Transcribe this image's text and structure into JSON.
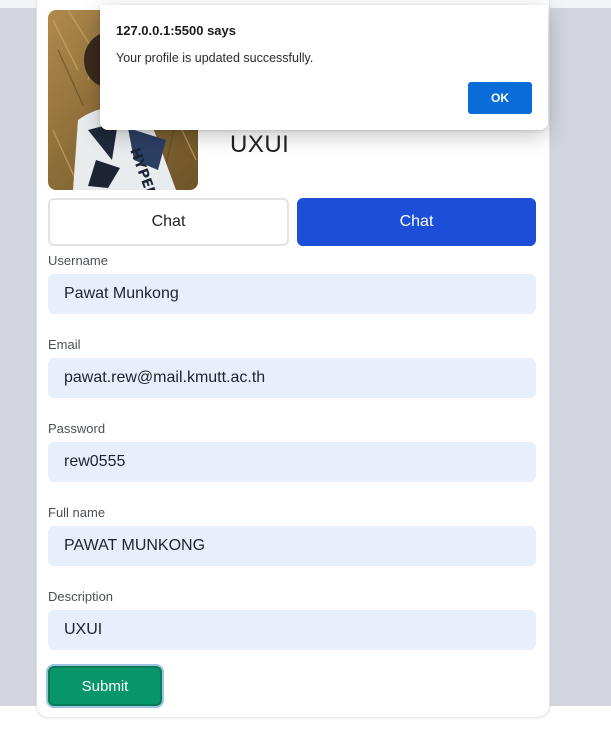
{
  "dialog": {
    "title": "127.0.0.1:5500 says",
    "message": "Your profile is updated successfully.",
    "ok_label": "OK"
  },
  "profile": {
    "name": "UXUI"
  },
  "buttons": {
    "chat_outline_label": "Chat",
    "chat_filled_label": "Chat",
    "submit_label": "Submit"
  },
  "form": {
    "fields": [
      {
        "label": "Username",
        "value": "Pawat Munkong"
      },
      {
        "label": "Email",
        "value": "pawat.rew@mail.kmutt.ac.th"
      },
      {
        "label": "Password",
        "value": "rew0555"
      },
      {
        "label": "Full name",
        "value": "PAWAT MUNKONG"
      },
      {
        "label": "Description",
        "value": "UXUI"
      }
    ]
  },
  "colors": {
    "primary": "#1d4ed8",
    "submit": "#079669",
    "input_bg": "#e8effc",
    "dialog_ok": "#0a6cd8"
  }
}
